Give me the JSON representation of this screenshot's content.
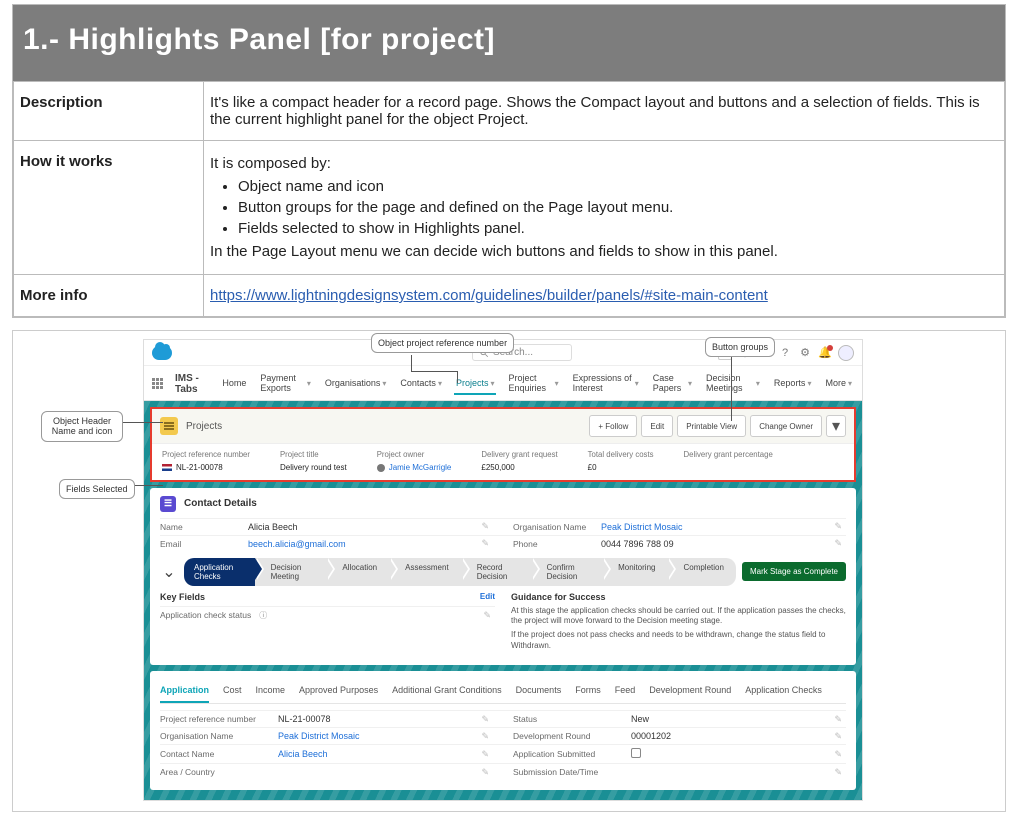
{
  "doc": {
    "title": "1.- Highlights Panel [for project]",
    "rows": {
      "description_label": "Description",
      "description_value": "It's like a compact header for a record page. Shows the Compact layout and buttons and a selection of fields. This is the current highlight panel for the object Project.",
      "how_label": "How it works",
      "how_intro": "It is composed by:",
      "how_items": {
        "a": "Object name and icon",
        "b": "Button groups for the page and defined on the Page layout menu.",
        "c": "Fields selected to show in Highlights panel."
      },
      "how_outro": "In the Page Layout menu we can decide wich buttons and fields to show in this panel.",
      "more_label": "More info",
      "more_link": "https://www.lightningdesignsystem.com/guidelines/builder/panels/#site-main-content"
    }
  },
  "callouts": {
    "ref": "Object project reference number",
    "btns": "Button groups",
    "header": "Object Header Name and icon",
    "fields": "Fields Selected"
  },
  "sf": {
    "search_placeholder": "Search...",
    "app_name": "IMS - Tabs",
    "nav": {
      "i0": "Home",
      "i1": "Payment Exports",
      "i2": "Organisations",
      "i3": "Contacts",
      "i4": "Projects",
      "i5": "Project Enquiries",
      "i6": "Expressions of Interest",
      "i7": "Case Papers",
      "i8": "Decision Meetings",
      "i9": "Reports",
      "i10": "More"
    }
  },
  "hp": {
    "object": "Projects",
    "buttons": {
      "follow": "+ Follow",
      "edit": "Edit",
      "print": "Printable View",
      "owner": "Change Owner"
    },
    "fields": {
      "f1": {
        "lbl": "Project reference number",
        "val": "NL-21-00078"
      },
      "f2": {
        "lbl": "Project title",
        "val": "Delivery round test"
      },
      "f3": {
        "lbl": "Project owner",
        "val": "Jamie McGarrigle"
      },
      "f4": {
        "lbl": "Delivery grant request",
        "val": "£250,000"
      },
      "f5": {
        "lbl": "Total delivery costs",
        "val": "£0"
      },
      "f6": {
        "lbl": "Delivery grant percentage",
        "val": ""
      }
    }
  },
  "contact": {
    "hdr": "Contact Details",
    "name_l": "Name",
    "name_v": "Alicia Beech",
    "email_l": "Email",
    "email_v": "beech.alicia@gmail.com",
    "org_l": "Organisation Name",
    "org_v": "Peak District Mosaic",
    "phone_l": "Phone",
    "phone_v": "0044 7896 788 09"
  },
  "path": {
    "s1": "Application Checks",
    "s2": "Decision Meeting",
    "s3": "Allocation",
    "s4": "Assessment",
    "s5": "Record Decision",
    "s6": "Confirm Decision",
    "s7": "Monitoring",
    "s8": "Completion",
    "mark": "Mark Stage as Complete"
  },
  "kf": {
    "hdr": "Key Fields",
    "edit": "Edit",
    "l1": "Application check status"
  },
  "gf": {
    "hdr": "Guidance for Success",
    "p1": "At this stage the application checks should be carried out. If the application passes the checks, the project will move forward to the Decision meeting stage.",
    "p2": "If the project does not pass checks and needs to be withdrawn, change the status field to Withdrawn."
  },
  "tabs": {
    "t1": "Application",
    "t2": "Cost",
    "t3": "Income",
    "t4": "Approved Purposes",
    "t5": "Additional Grant Conditions",
    "t6": "Documents",
    "t7": "Forms",
    "t8": "Feed",
    "t9": "Development Round",
    "t10": "Application Checks"
  },
  "details": {
    "l1": "Project reference number",
    "v1": "NL-21-00078",
    "l2": "Organisation Name",
    "v2": "Peak District Mosaic",
    "l3": "Contact Name",
    "v3": "Alicia Beech",
    "l4": "Area / Country",
    "v4": "",
    "r1": "Status",
    "vr1": "New",
    "r2": "Development Round",
    "vr2": "00001202",
    "r3": "Application Submitted",
    "vr3": "",
    "r4": "Submission Date/Time",
    "vr4": ""
  }
}
